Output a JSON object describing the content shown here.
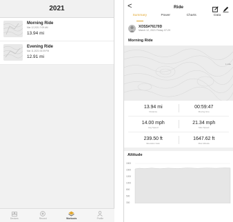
{
  "left": {
    "title": "2021",
    "rides": [
      {
        "name": "Morning Ride",
        "date": "Mar 12,2021 7:09 AM",
        "distance": "13.94 mi"
      },
      {
        "name": "Evening Ride",
        "date": "Mar 11,2021 06:09 PM",
        "distance": "12.91 mi"
      }
    ],
    "nav": [
      {
        "label": "Devices",
        "icon": "devices-icon"
      },
      {
        "label": "Record",
        "icon": "record-icon"
      },
      {
        "label": "Workouts",
        "icon": "workouts-icon"
      },
      {
        "label": "Profile",
        "icon": "profile-icon"
      }
    ],
    "active_nav": "Workouts"
  },
  "right": {
    "title": "Ride",
    "back_glyph": "<",
    "tabs": [
      "Summary",
      "Power",
      "Charts",
      "Data"
    ],
    "active_tab": "Summary",
    "user": {
      "name": "XOSS#76170D",
      "date": "March 12, 2021 Friday 07:29"
    },
    "ride_title": "Morning Ride",
    "map_scale": "1 mile",
    "stats": [
      [
        {
          "value": "13.94 mi",
          "label": "Distance"
        },
        {
          "value": "00:59:47",
          "label": "Moving time"
        }
      ],
      [
        {
          "value": "14.00 mph",
          "label": "Avg Speed"
        },
        {
          "value": "21.34 mph",
          "label": "Max Speed"
        }
      ],
      [
        {
          "value": "239.50 ft",
          "label": "Elevation Gain"
        },
        {
          "value": "1647.62 ft",
          "label": "Max Altitude"
        }
      ]
    ],
    "altitude": {
      "title": "Altitude",
      "yticks": [
        "1800",
        "1500",
        "1200",
        "1000",
        "800",
        "500",
        "300"
      ],
      "fill_color": "#e6e6e6"
    }
  },
  "colors": {
    "accent": "#e0a62e"
  }
}
